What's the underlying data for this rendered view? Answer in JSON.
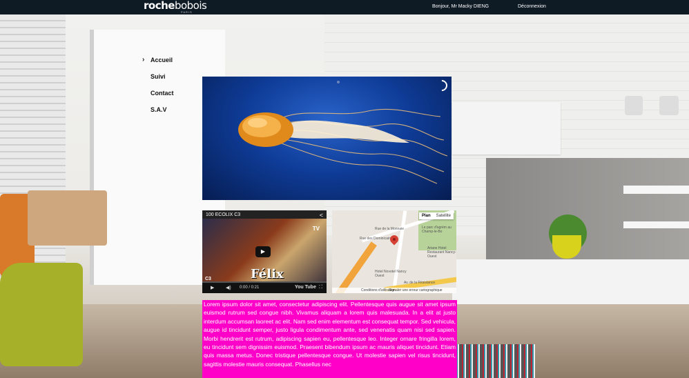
{
  "header": {
    "brand_bold": "roche",
    "brand_light": "bobois",
    "brand_sub": "PARIS",
    "greeting": "Bonjour, Mr Macky DIENG",
    "logout": "Déconnexion"
  },
  "nav": {
    "items": [
      {
        "label": "Accueil",
        "active": true
      },
      {
        "label": "Suivi",
        "active": false
      },
      {
        "label": "Contact",
        "active": false
      },
      {
        "label": "S.A.V",
        "active": false
      }
    ],
    "active_marker": "›"
  },
  "hero": {
    "subject": "jellyfish",
    "loading_indicator": "spinner"
  },
  "video": {
    "title": "100 ECOLIX C3",
    "sign_text": "Félix",
    "channel_badge": "TV",
    "channel": "C3",
    "time": "0:00 / 0:21",
    "provider": "You Tube",
    "icons": [
      "share-icon",
      "play-icon",
      "volume-icon",
      "fullscreen-icon"
    ]
  },
  "map": {
    "type_buttons": [
      "Plan",
      "Satellite"
    ],
    "selected_type": "Plan",
    "labels": {
      "street1": "Rue de la Monnaie",
      "street2": "Rue des Dominicains",
      "place": "Le parc d'agrém au Champ-le-Bo",
      "hotel1": "Ariane Hotel Restaurant Nancy-Ouest",
      "hotel2": "Hotel Novotel Nancy Ouest",
      "avenue": "Av. de la Résistance"
    },
    "footer": {
      "terms": "Conditions d'utilisation",
      "report": "Signaler une erreur cartographique"
    }
  },
  "lorem": {
    "text": "Lorem ipsum dolor sit amet, consectetur adipiscing elit. Pellentesque quis augue sit amet ipsum euismod rutrum sed congue nibh. Vivamus aliquam a lorem quis malesuada. In a elit at justo interdum accumsan laoreet ac elit. Nam sed enim elementum est consequat tempor. Sed vehicula, augue id tincidunt semper, justo ligula condimentum ante, sed venenatis quam nisi sed sapien. Morbi hendrerit est rutrum, adipiscing sapien eu, pellentesque leo. Integer ornare fringilla lorem, eu tincidunt sem dignissim euismod. Praesent bibendum ipsum ac mauris aliquet tincidunt. Etiam quis massa metus. Donec tristique pellentesque congue. Ut molestie sapien vel risus tincidunt, sagittis molestie mauris consequat. Phasellus nec",
    "background": "#ff00c8"
  },
  "colors": {
    "topbar": "#0e1a24",
    "lorem_bg": "#ff00c8",
    "map_pin": "#d64034"
  }
}
